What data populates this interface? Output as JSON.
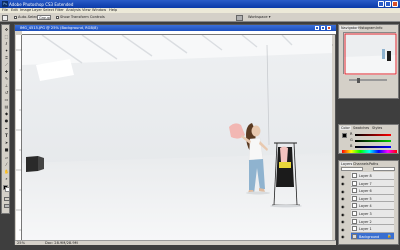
{
  "window": {
    "title": "Adobe Photoshop CS3 Extended",
    "app_icon": "Ps"
  },
  "menu": [
    "File",
    "Edit",
    "Image",
    "Layer",
    "Select",
    "Filter",
    "Analysis",
    "View",
    "Window",
    "Help"
  ],
  "options": {
    "auto_select": "Auto-Select:",
    "auto_select_value": "Group",
    "transform": "Show Transform Controls",
    "workspace": "Workspace ▾"
  },
  "document": {
    "title": "IMG_4515.JPG @ 25% (Background, RGB/8)",
    "zoom": "25%",
    "doc_info": "Doc: 28.9M/28.9M"
  },
  "panels": {
    "navigator_tabs": [
      "Navigator",
      "Histogram",
      "Info"
    ],
    "color_tabs": [
      "Color",
      "Swatches",
      "Styles"
    ],
    "color_channels": [
      "R",
      "G",
      "B"
    ],
    "layers_tabs": [
      "Layers",
      "Channels",
      "Paths"
    ],
    "layers": [
      "Layer 8",
      "Layer 7",
      "Layer 6",
      "Layer 5",
      "Layer 4",
      "Layer 3",
      "Layer 2",
      "Layer 1",
      "Background"
    ]
  },
  "colors": {
    "titlebar": "#0a3aa8",
    "chrome": "#d4d0c8",
    "workspace": "#3e3e3e",
    "selection": "#3a6fd0"
  },
  "icons": [
    "move-icon",
    "marquee-icon",
    "lasso-icon",
    "magic-wand-icon",
    "crop-icon",
    "slice-icon",
    "healing-icon",
    "brush-icon",
    "stamp-icon",
    "history-brush-icon",
    "eraser-icon",
    "gradient-icon",
    "blur-icon",
    "dodge-icon",
    "pen-icon",
    "type-icon",
    "path-select-icon",
    "shape-icon",
    "notes-icon",
    "eyedropper-icon",
    "hand-icon",
    "zoom-icon"
  ]
}
